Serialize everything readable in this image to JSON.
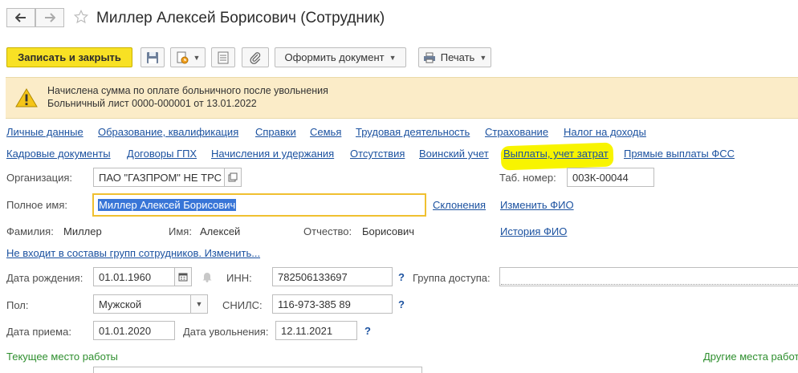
{
  "window": {
    "title": "Миллер Алексей Борисович (Сотрудник)"
  },
  "toolbar": {
    "save_close_label": "Записать и закрыть",
    "create_document_label": "Оформить документ",
    "print_label": "Печать"
  },
  "banner": {
    "line1": "Начислена сумма по оплате больничного после увольнения",
    "line2": "Больничный лист 0000-000001 от 13.01.2022"
  },
  "links_row1": [
    "Личные данные",
    "Образование, квалификация",
    "Справки",
    "Семья",
    "Трудовая деятельность",
    "Страхование",
    "Налог на доходы"
  ],
  "links_row2": [
    "Кадровые документы",
    "Договоры ГПХ",
    "Начисления и удержания",
    "Отсутствия",
    "Воинский учет",
    "Выплаты, учет затрат",
    "Прямые выплаты ФСС"
  ],
  "form": {
    "organization_label": "Организация:",
    "organization_value": "ПАО \"ГАЗПРОМ\" НЕ ТРС",
    "tab_number_label": "Таб. номер:",
    "tab_number_value": "003К-00044",
    "full_name_label": "Полное имя:",
    "full_name_value": "Миллер Алексей Борисович",
    "declensions_link": "Склонения",
    "change_name_link": "Изменить ФИО",
    "surname_label": "Фамилия:",
    "surname_value": "Миллер",
    "name_label": "Имя:",
    "name_value": "Алексей",
    "patronymic_label": "Отчество:",
    "patronymic_value": "Борисович",
    "name_history_link": "История ФИО",
    "groups_link": "Не входит в составы групп сотрудников. Изменить...",
    "birth_date_label": "Дата рождения:",
    "birth_date_value": "01.01.1960",
    "inn_label": "ИНН:",
    "inn_value": "782506133697",
    "access_group_label": "Группа доступа:",
    "access_group_value": "",
    "gender_label": "Пол:",
    "gender_value": "Мужской",
    "snils_label": "СНИЛС:",
    "snils_value": "116-973-385 89",
    "hire_date_label": "Дата приема:",
    "hire_date_value": "01.01.2020",
    "dismissal_date_label": "Дата увольнения:",
    "dismissal_date_value": "12.11.2021",
    "help_mark": "?"
  },
  "sections": {
    "current_workplace": "Текущее место работы",
    "other_workplaces": "Другие места работ"
  },
  "colors": {
    "accent_yellow": "#f8e124",
    "link_blue": "#1c52a0",
    "banner_bg": "#fbecc8",
    "section_green": "#2f8f2f",
    "highlight": "#f8f400"
  },
  "icons": {
    "back": "arrow-left-icon",
    "forward": "arrow-right-icon",
    "favorite": "star-icon",
    "save": "floppy-disk-icon",
    "history": "document-clock-icon",
    "list": "report-list-icon",
    "attach": "paperclip-icon",
    "print": "printer-icon",
    "warning": "warning-icon",
    "open": "open-icon",
    "calendar": "calendar-icon",
    "bell": "bell-icon",
    "dropdown": "chevron-down-icon"
  }
}
